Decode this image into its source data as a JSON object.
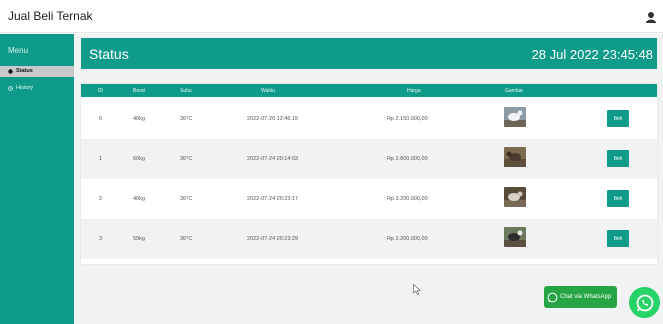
{
  "app": {
    "title": "Jual Beli Ternak",
    "user_icon": "user-icon"
  },
  "sidebar": {
    "menu_label": "Menu",
    "items": [
      {
        "label": "Status",
        "icon": "circle-icon",
        "active": true
      },
      {
        "label": "History",
        "icon": "history-icon",
        "active": false
      }
    ]
  },
  "status": {
    "title": "Status",
    "datetime": "28 Jul 2022 23:45:48"
  },
  "table": {
    "headers": [
      "ID",
      "Berat",
      "Suhu",
      "Waktu",
      "Harga",
      "Gambar"
    ],
    "rows": [
      {
        "id": "0",
        "berat": "40kg",
        "suhu": "36°C",
        "waktu": "2022-07-26 12:46:15",
        "harga": "Rp 2.150.000,00",
        "button": "Beli"
      },
      {
        "id": "1",
        "berat": "60kg",
        "suhu": "36°C",
        "waktu": "2022-07-24 20:14:03",
        "harga": "Rp 2.800.000,00",
        "button": "Beli"
      },
      {
        "id": "2",
        "berat": "40kg",
        "suhu": "36°C",
        "waktu": "2022-07-24 20:23:17",
        "harga": "Rp 3.200.000,00",
        "button": "Beli"
      },
      {
        "id": "3",
        "berat": "59kg",
        "suhu": "36°C",
        "waktu": "2022-07-24 20:23:29",
        "harga": "Rp 2.200.000,00",
        "button": "Beli"
      }
    ]
  },
  "whatsapp": {
    "chat_label": "Chat via WhatsApp"
  },
  "colors": {
    "primary": "#0f9b8a",
    "whatsapp": "#25d366"
  }
}
